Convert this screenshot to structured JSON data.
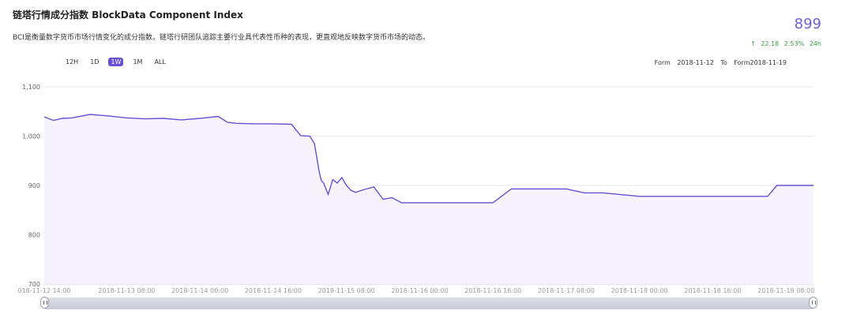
{
  "header": {
    "title": "链塔行情成分指数 BlockData Component Index",
    "description": "BCI是衡量数字货币市场行情变化的成分指数。链塔行研团队追踪主要行业具代表性币种的表现，更直观地反映数字货币市场的动态。",
    "price": "899",
    "change_arrow": "↑",
    "change_abs": "22.18",
    "change_pct": "2.53%",
    "change_period": "24h"
  },
  "range_buttons": [
    "12H",
    "1D",
    "1W",
    "1M",
    "ALL"
  ],
  "active_range": "1W",
  "date_range": {
    "from_label": "Form",
    "from": "2018-11-12",
    "to_label": "To",
    "to": "Form2018-11-19"
  },
  "colors": {
    "line": "#6a4fd6",
    "area": "#f6f3fd",
    "up": "#35a244",
    "accent": "#6a4fd6"
  },
  "chart_data": {
    "type": "area",
    "title": "",
    "xlabel": "",
    "ylabel": "",
    "ylim": [
      700,
      1100
    ],
    "yticks": [
      700,
      800,
      900,
      1000,
      1100
    ],
    "ytick_labels": [
      "700",
      "800",
      "900",
      "1,000",
      "1,100"
    ],
    "xlim": [
      "2018-11-12 14:00",
      "2018-11-19 14:00"
    ],
    "xticks": [
      "2018-11-12 14:00",
      "2018-11-13 08:00",
      "2018-11-14 00:00",
      "2018-11-14 16:00",
      "2018-11-15 08:00",
      "2018-11-16 00:00",
      "2018-11-16 16:00",
      "2018-11-17 08:00",
      "2018-11-18 00:00",
      "2018-11-18 16:00",
      "2018-11-19 08:00"
    ],
    "xtick_labels": [
      "018-11-12 14:00",
      "2018-11-13 08:00",
      "2018-11-14 00:00",
      "2018-11-14 16:00",
      "2018-11-15 08:00",
      "2018-11-16 00:00",
      "2018-11-16 16:00",
      "2018-11-17 08:00",
      "2018-11-18 00:00",
      "2018-11-18 16:00",
      "2018-11-19 08:00"
    ],
    "grid": true,
    "series": [
      {
        "x": [
          "2018-11-12 14:00",
          "2018-11-12 16:00",
          "2018-11-12 18:00",
          "2018-11-12 20:00",
          "2018-11-13 00:00",
          "2018-11-13 04:00",
          "2018-11-13 08:00",
          "2018-11-13 12:00",
          "2018-11-13 16:00",
          "2018-11-13 20:00",
          "2018-11-14 00:00",
          "2018-11-14 04:00",
          "2018-11-14 06:00",
          "2018-11-14 08:00",
          "2018-11-14 12:00",
          "2018-11-14 16:00",
          "2018-11-14 20:00",
          "2018-11-14 22:00",
          "2018-11-15 00:00",
          "2018-11-15 01:00",
          "2018-11-15 02:00",
          "2018-11-15 02:30",
          "2018-11-15 03:00",
          "2018-11-15 04:00",
          "2018-11-15 05:00",
          "2018-11-15 06:00",
          "2018-11-15 07:00",
          "2018-11-15 08:00",
          "2018-11-15 09:00",
          "2018-11-15 10:00",
          "2018-11-15 12:00",
          "2018-11-15 14:00",
          "2018-11-15 16:00",
          "2018-11-15 18:00",
          "2018-11-15 20:00",
          "2018-11-15 22:00",
          "2018-11-16 00:00",
          "2018-11-16 08:00",
          "2018-11-16 16:00",
          "2018-11-16 20:00",
          "2018-11-17 04:00",
          "2018-11-17 08:00",
          "2018-11-17 12:00",
          "2018-11-17 16:00",
          "2018-11-18 00:00",
          "2018-11-18 16:00",
          "2018-11-19 04:00",
          "2018-11-19 06:00",
          "2018-11-19 14:00"
        ],
        "values": [
          1039,
          1032,
          1036,
          1037,
          1044,
          1041,
          1037,
          1035,
          1036,
          1033,
          1036,
          1040,
          1028,
          1026,
          1025,
          1025,
          1024,
          1001,
          1000,
          985,
          930,
          910,
          905,
          882,
          912,
          905,
          916,
          900,
          890,
          886,
          892,
          897,
          872,
          875,
          865,
          865,
          865,
          865,
          865,
          893,
          893,
          893,
          885,
          885,
          878,
          878,
          878,
          900,
          900
        ]
      }
    ]
  }
}
